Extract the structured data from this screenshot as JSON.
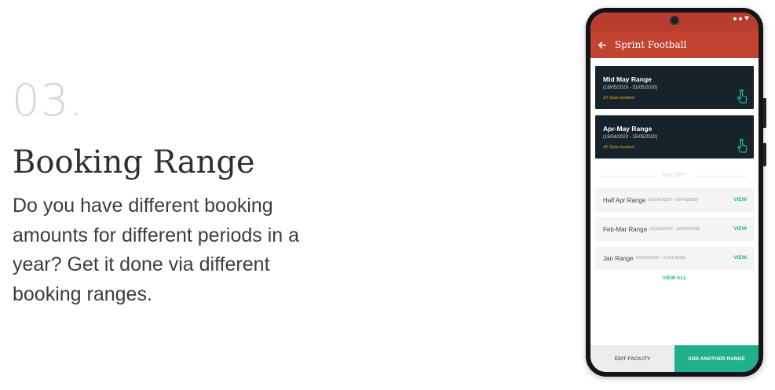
{
  "feature": {
    "number": "03.",
    "title": "Booking Range",
    "description": "Do you have different booking amounts for different periods in a year? Get it done via different booking ranges."
  },
  "app": {
    "title": "Sprint Football",
    "back_icon": "arrow-left-icon",
    "active_ranges": [
      {
        "name": "Mid May Range",
        "dates": "(18/05/2020 - 31/05/2020)",
        "slots": "20 Slots booked",
        "icon": "tap-hand-icon"
      },
      {
        "name": "Apr-May Range",
        "dates": "(15/04/2020 - 15/05/2020)",
        "slots": "40 Slots booked",
        "icon": "tap-hand-icon"
      }
    ],
    "history_label": "HISTORY",
    "history": [
      {
        "name": "Half Apr Range",
        "dates": "(01/04/2020 - 14/04/2020)",
        "action": "VIEW"
      },
      {
        "name": "Feb-Mar Range",
        "dates": "(01/02/2020 - 31/03/2020)",
        "action": "VIEW"
      },
      {
        "name": "Jan Range",
        "dates": "(01/01/2020 - 31/01/2020)",
        "action": "VIEW"
      }
    ],
    "view_all": "VIEW ALL",
    "buttons": {
      "edit": "EDIT FACILITY",
      "add": "ADD ANOTHER RANGE"
    }
  },
  "colors": {
    "brand_red": "#c34332",
    "card_dark": "#16232b",
    "accent_green": "#1fb08c",
    "slots_orange": "#e0a52b"
  }
}
